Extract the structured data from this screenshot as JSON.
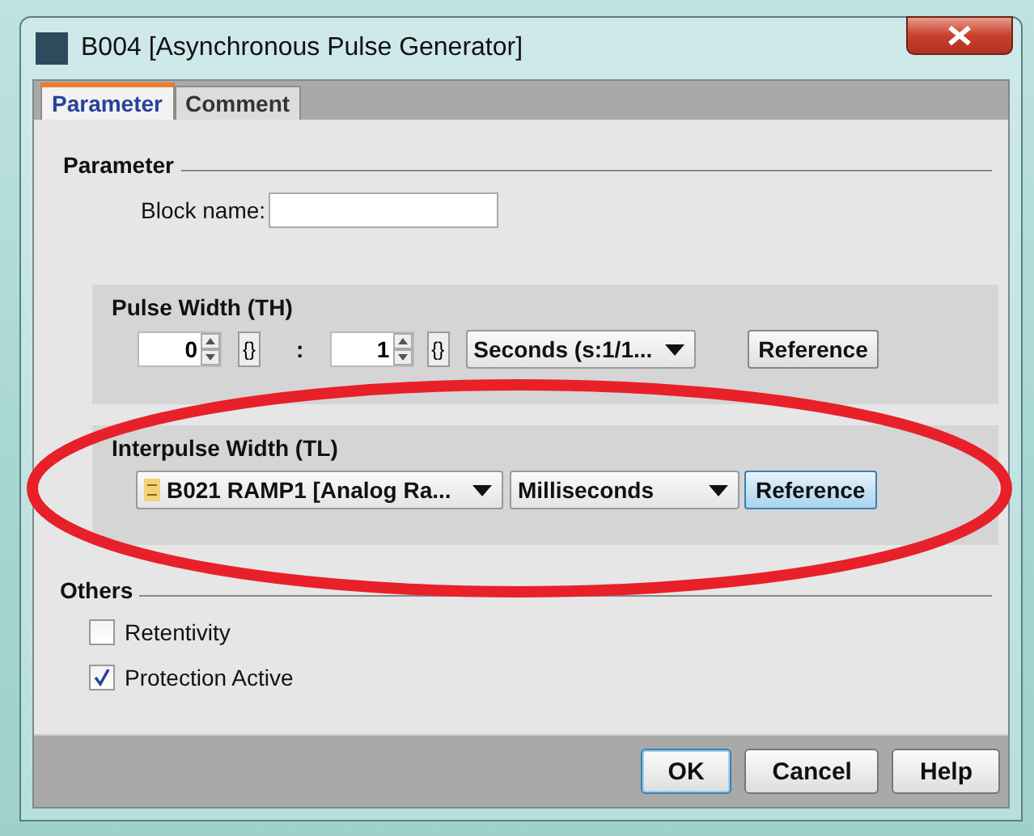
{
  "window": {
    "title": "B004 [Asynchronous Pulse Generator]"
  },
  "tabs": [
    {
      "label": "Parameter",
      "selected": true
    },
    {
      "label": "Comment",
      "selected": false
    }
  ],
  "parameter": {
    "heading": "Parameter",
    "block_name_label": "Block name:"
  },
  "pulse_width": {
    "title": "Pulse Width (TH)",
    "value_1": "0",
    "brace_1": "{}",
    "separator": ":",
    "value_2": "1",
    "brace_2": "{}",
    "unit": "Seconds (s:1/1...",
    "reference": {
      "label": "Reference",
      "focused": false
    }
  },
  "interpulse_width": {
    "title": "Interpulse Width (TL)",
    "source": "B021 RAMP1 [Analog Ra...",
    "unit": "Milliseconds",
    "reference": {
      "label": "Reference",
      "focused": true
    }
  },
  "others": {
    "heading": "Others",
    "options": [
      {
        "label": "Retentivity",
        "checked": false
      },
      {
        "label": "Protection Active",
        "checked": true
      }
    ]
  },
  "buttons": [
    {
      "label": "OK",
      "default": true
    },
    {
      "label": "Cancel",
      "default": false
    },
    {
      "label": "Help",
      "default": false
    }
  ]
}
